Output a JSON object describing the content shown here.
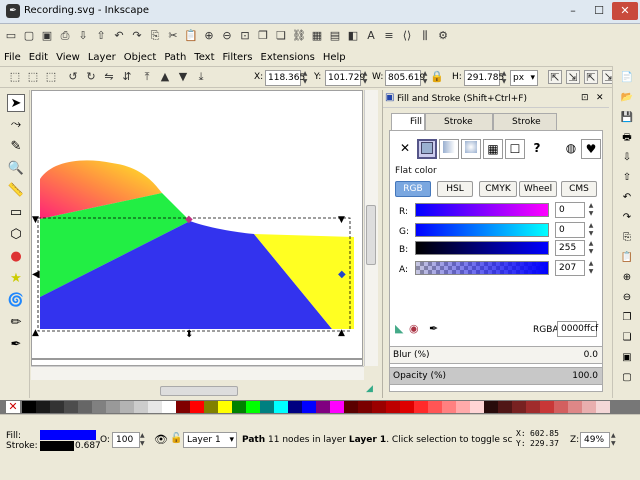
{
  "window": {
    "title": "Recording.svg - Inkscape",
    "app_icon": "inkscape-icon"
  },
  "menu": [
    "File",
    "Edit",
    "View",
    "Layer",
    "Object",
    "Path",
    "Text",
    "Filters",
    "Extensions",
    "Help"
  ],
  "controls": {
    "x_label": "X:",
    "x_value": "118.365",
    "y_label": "Y:",
    "y_value": "101.729",
    "w_label": "W:",
    "w_value": "805.619",
    "h_label": "H:",
    "h_value": "291.785",
    "unit": "px"
  },
  "panel": {
    "title": "Fill and Stroke (Shift+Ctrl+F)",
    "tabs": {
      "fill": "Fill",
      "stroke_paint": "Stroke paint",
      "stroke_style": "Stroke style"
    },
    "flat_color_label": "Flat color",
    "modes": [
      "RGB",
      "HSL",
      "CMYK",
      "Wheel",
      "CMS"
    ],
    "channels": [
      {
        "label": "R:",
        "value": "0"
      },
      {
        "label": "G:",
        "value": "0"
      },
      {
        "label": "B:",
        "value": "255"
      },
      {
        "label": "A:",
        "value": "207"
      }
    ],
    "rgba_label": "RGBA:",
    "rgba_value": "0000ffcf",
    "blur_label": "Blur (%)",
    "blur_value": "0.0",
    "opacity_label": "Opacity (%)",
    "opacity_value": "100.0"
  },
  "status": {
    "fill_label": "Fill:",
    "stroke_label": "Stroke:",
    "stroke_width": "0.687",
    "opacity_label": "O:",
    "opacity_value": "100",
    "layer": "Layer 1",
    "message_bold": "Path",
    "message_rest": " 11 nodes in layer ",
    "message_layer": "Layer 1",
    "message_end": ". Click selection to toggle scale/rotatio",
    "x_label": "X:",
    "x_value": "602.85",
    "y_label": "Y:",
    "y_value": "229.37",
    "z_label": "Z:",
    "zoom": "49%"
  },
  "colors": {
    "fill": "#0000ff",
    "selected_blue": "#3333ee",
    "green": "#22ee44",
    "yellow": "#ffff22"
  }
}
